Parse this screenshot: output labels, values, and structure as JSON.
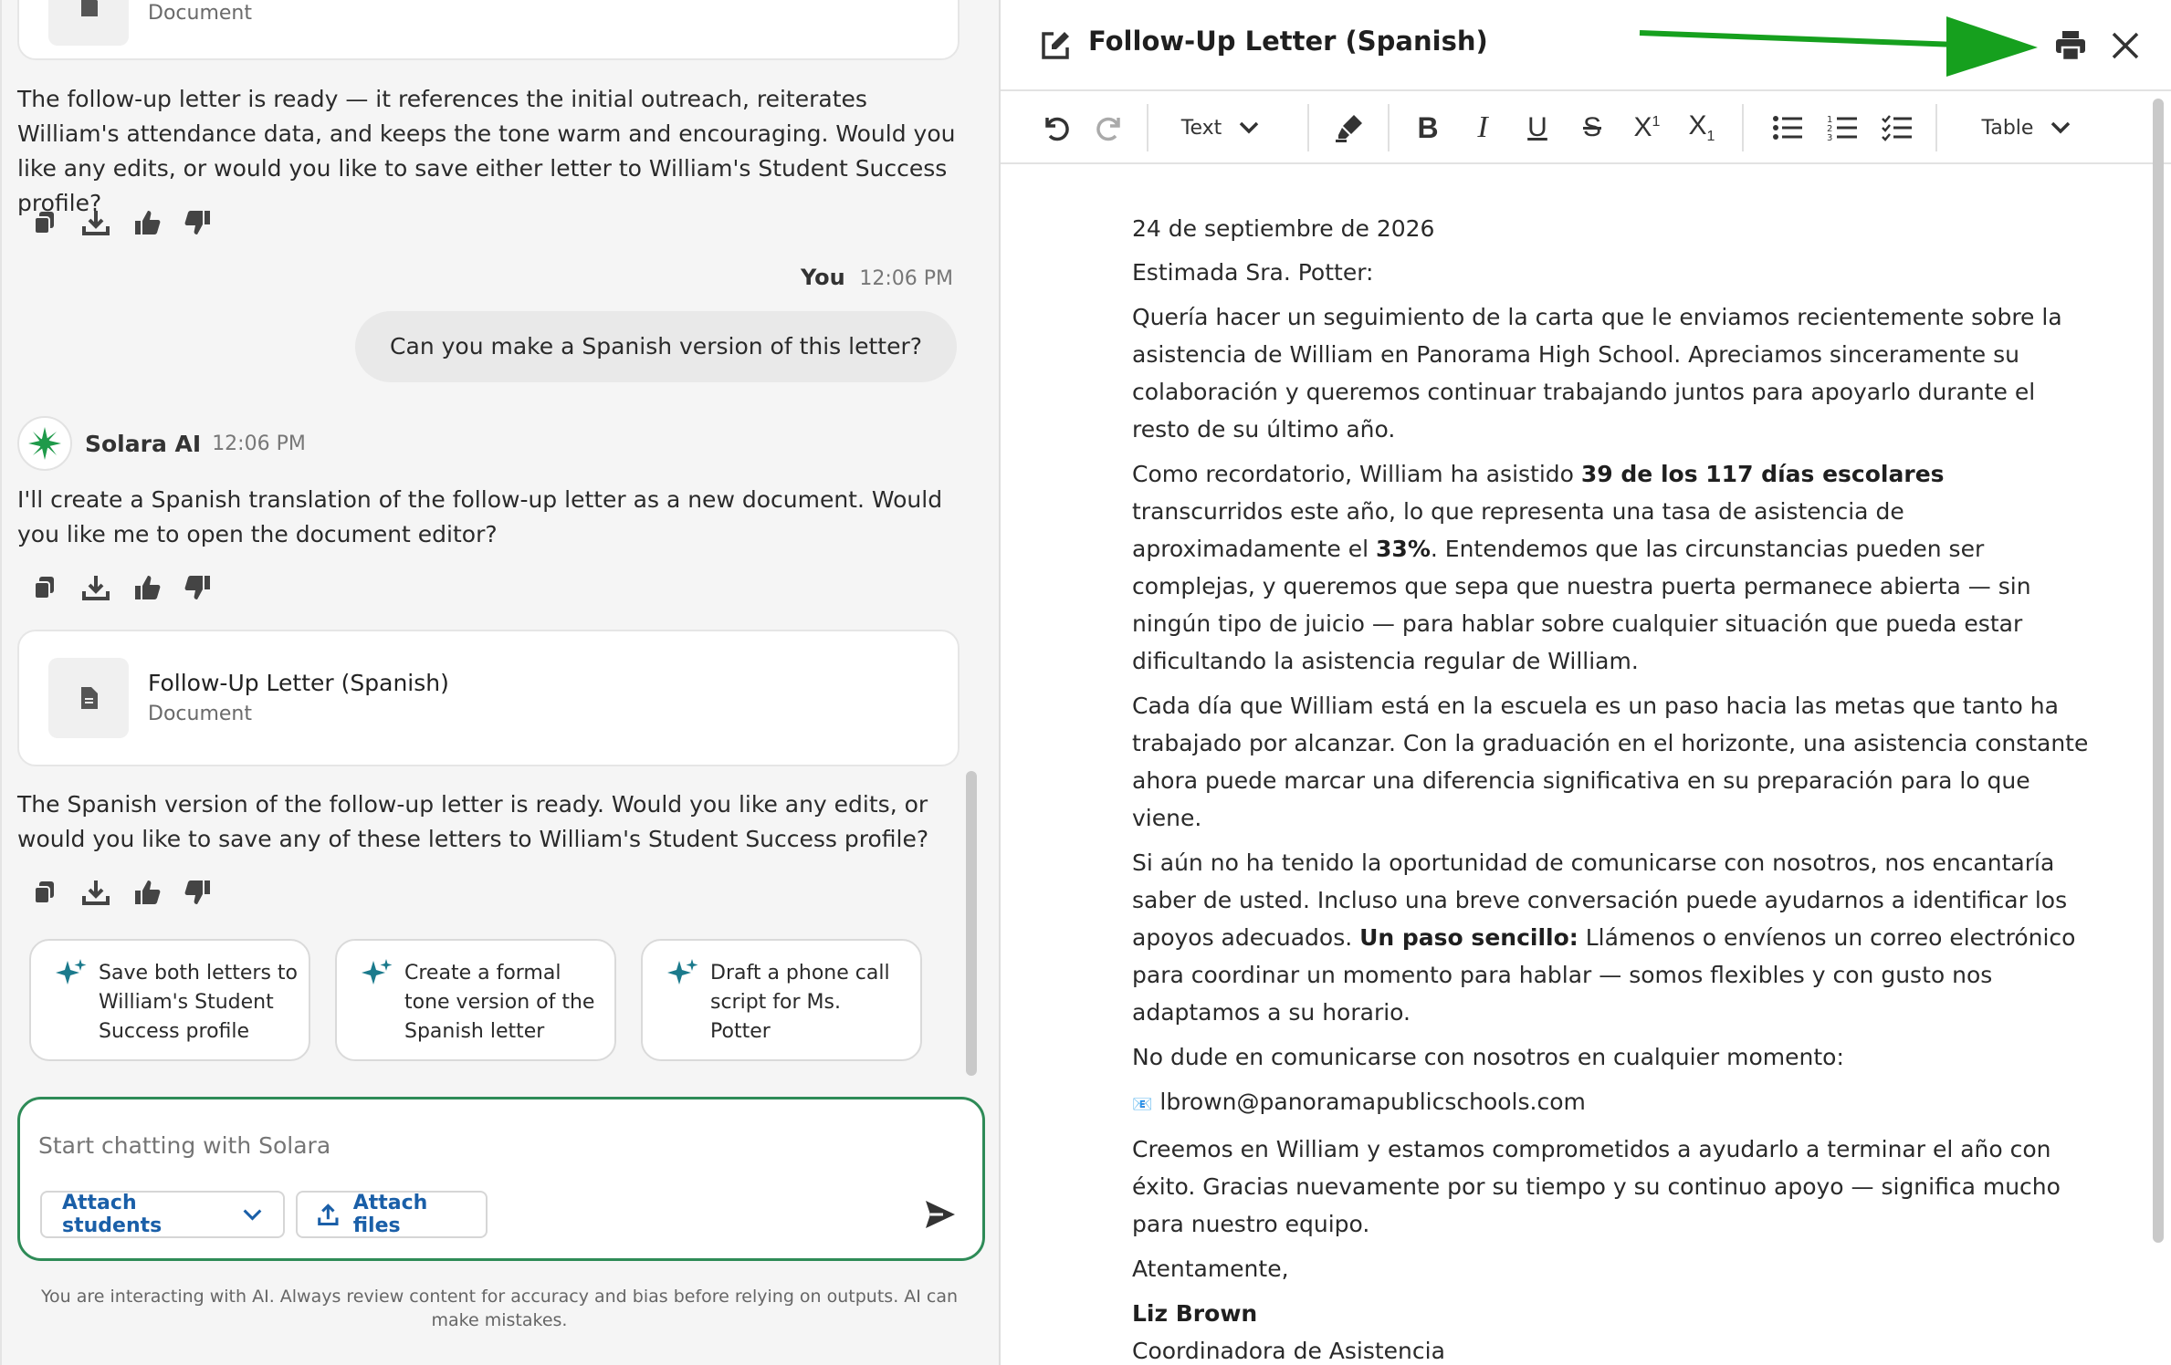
{
  "chat": {
    "top_card": {
      "type": "Document"
    },
    "msg1": "The follow-up letter is ready — it references the initial outreach, reiterates William's attendance data, and keeps the tone warm and encouraging. Would you like any edits, or would you like to save either letter to William's Student Success profile?",
    "user": {
      "name": "You",
      "time": "12:06 PM",
      "message": "Can you make a Spanish version of this letter?"
    },
    "ai": {
      "name": "Solara AI",
      "time": "12:06 PM"
    },
    "msg2": "I'll create a Spanish translation of the follow-up letter as a new document. Would you like me to open the document editor?",
    "doc_card": {
      "title": "Follow-Up Letter (Spanish)",
      "type": "Document"
    },
    "msg3": "The Spanish version of the follow-up letter is ready. Would you like any edits, or would you like to save any of these letters to William's Student Success profile?",
    "suggestions": [
      {
        "line1": "Save both letters to",
        "line2": "William's Student",
        "line3": "Success profile"
      },
      {
        "line1": "Create a formal",
        "line2": "tone version of the",
        "line3": "Spanish letter"
      },
      {
        "line1": "Draft a phone call",
        "line2": "script for Ms.",
        "line3": "Potter"
      }
    ],
    "composer": {
      "placeholder": "Start chatting with Solara",
      "attach_students": "Attach students",
      "attach_files": "Attach files"
    },
    "disclaimer": "You are interacting with AI. Always review content for accuracy and bias before relying on outputs. AI can make mistakes."
  },
  "editor": {
    "title": "Follow-Up Letter (Spanish)",
    "toolbar": {
      "text_style": "Text",
      "table": "Table"
    },
    "letter": {
      "date": "24 de septiembre de 2026",
      "greeting": "Estimada Sra. Potter:",
      "p1": "Quería hacer un seguimiento de la carta que le enviamos recientemente sobre la asistencia de William en Panorama High School. Apreciamos sinceramente su colaboración y queremos continuar trabajando juntos para apoyarlo durante el resto de su último año.",
      "p2_a": "Como recordatorio, William ha asistido ",
      "p2_bold1": "39 de los 117 días escolares",
      "p2_b": " transcurridos este año, lo que representa una tasa de asistencia de aproximadamente el ",
      "p2_bold2": "33%",
      "p2_c": ". Entendemos que las circunstancias pueden ser complejas, y queremos que sepa que nuestra puerta permanece abierta — sin ningún tipo de juicio — para hablar sobre cualquier situación que pueda estar dificultando la asistencia regular de William.",
      "p3": "Cada día que William está en la escuela es un paso hacia las metas que tanto ha trabajado por alcanzar. Con la graduación en el horizonte, una asistencia constante ahora puede marcar una diferencia significativa en su preparación para lo que viene.",
      "p4_a": "Si aún no ha tenido la oportunidad de comunicarse con nosotros, nos encantaría saber de usted. Incluso una breve conversación puede ayudarnos a identificar los apoyos adecuados. ",
      "p4_bold": "Un paso sencillo:",
      "p4_b": " Llámenos o envíenos un correo electrónico para coordinar un momento para hablar — somos flexibles y con gusto nos adaptamos a su horario.",
      "p5": "No dude en comunicarse con nosotros en cualquier momento:",
      "email_icon": "📧",
      "email": "lbrown@panoramapublicschools.com",
      "p6": "Creemos en William y estamos comprometidos a ayudarlo a terminar el año con éxito. Gracias nuevamente por su tiempo y su continuo apoyo — significa mucho para nuestro equipo.",
      "closing": "Atentamente,",
      "signer": "Liz Brown",
      "signer_title": "Coordinadora de Asistencia"
    }
  },
  "colors": {
    "accent_green": "#2e8b57",
    "link_blue": "#1a5fa8",
    "spark_teal": "#1b7a8c",
    "annotation_arrow": "#16a01e"
  }
}
